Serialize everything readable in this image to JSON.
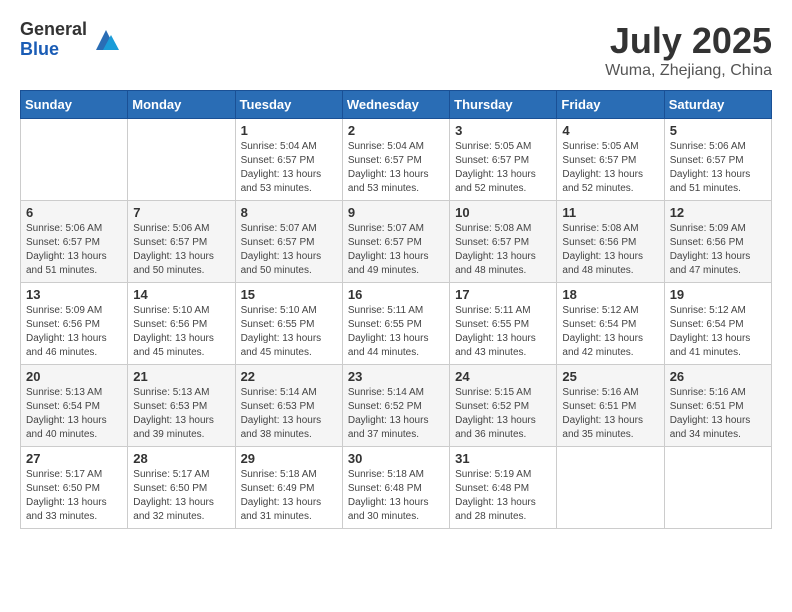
{
  "header": {
    "logo_general": "General",
    "logo_blue": "Blue",
    "month_title": "July 2025",
    "location": "Wuma, Zhejiang, China"
  },
  "days_of_week": [
    "Sunday",
    "Monday",
    "Tuesday",
    "Wednesday",
    "Thursday",
    "Friday",
    "Saturday"
  ],
  "weeks": [
    [
      {
        "day": "",
        "info": ""
      },
      {
        "day": "",
        "info": ""
      },
      {
        "day": "1",
        "info": "Sunrise: 5:04 AM\nSunset: 6:57 PM\nDaylight: 13 hours and 53 minutes."
      },
      {
        "day": "2",
        "info": "Sunrise: 5:04 AM\nSunset: 6:57 PM\nDaylight: 13 hours and 53 minutes."
      },
      {
        "day": "3",
        "info": "Sunrise: 5:05 AM\nSunset: 6:57 PM\nDaylight: 13 hours and 52 minutes."
      },
      {
        "day": "4",
        "info": "Sunrise: 5:05 AM\nSunset: 6:57 PM\nDaylight: 13 hours and 52 minutes."
      },
      {
        "day": "5",
        "info": "Sunrise: 5:06 AM\nSunset: 6:57 PM\nDaylight: 13 hours and 51 minutes."
      }
    ],
    [
      {
        "day": "6",
        "info": "Sunrise: 5:06 AM\nSunset: 6:57 PM\nDaylight: 13 hours and 51 minutes."
      },
      {
        "day": "7",
        "info": "Sunrise: 5:06 AM\nSunset: 6:57 PM\nDaylight: 13 hours and 50 minutes."
      },
      {
        "day": "8",
        "info": "Sunrise: 5:07 AM\nSunset: 6:57 PM\nDaylight: 13 hours and 50 minutes."
      },
      {
        "day": "9",
        "info": "Sunrise: 5:07 AM\nSunset: 6:57 PM\nDaylight: 13 hours and 49 minutes."
      },
      {
        "day": "10",
        "info": "Sunrise: 5:08 AM\nSunset: 6:57 PM\nDaylight: 13 hours and 48 minutes."
      },
      {
        "day": "11",
        "info": "Sunrise: 5:08 AM\nSunset: 6:56 PM\nDaylight: 13 hours and 48 minutes."
      },
      {
        "day": "12",
        "info": "Sunrise: 5:09 AM\nSunset: 6:56 PM\nDaylight: 13 hours and 47 minutes."
      }
    ],
    [
      {
        "day": "13",
        "info": "Sunrise: 5:09 AM\nSunset: 6:56 PM\nDaylight: 13 hours and 46 minutes."
      },
      {
        "day": "14",
        "info": "Sunrise: 5:10 AM\nSunset: 6:56 PM\nDaylight: 13 hours and 45 minutes."
      },
      {
        "day": "15",
        "info": "Sunrise: 5:10 AM\nSunset: 6:55 PM\nDaylight: 13 hours and 45 minutes."
      },
      {
        "day": "16",
        "info": "Sunrise: 5:11 AM\nSunset: 6:55 PM\nDaylight: 13 hours and 44 minutes."
      },
      {
        "day": "17",
        "info": "Sunrise: 5:11 AM\nSunset: 6:55 PM\nDaylight: 13 hours and 43 minutes."
      },
      {
        "day": "18",
        "info": "Sunrise: 5:12 AM\nSunset: 6:54 PM\nDaylight: 13 hours and 42 minutes."
      },
      {
        "day": "19",
        "info": "Sunrise: 5:12 AM\nSunset: 6:54 PM\nDaylight: 13 hours and 41 minutes."
      }
    ],
    [
      {
        "day": "20",
        "info": "Sunrise: 5:13 AM\nSunset: 6:54 PM\nDaylight: 13 hours and 40 minutes."
      },
      {
        "day": "21",
        "info": "Sunrise: 5:13 AM\nSunset: 6:53 PM\nDaylight: 13 hours and 39 minutes."
      },
      {
        "day": "22",
        "info": "Sunrise: 5:14 AM\nSunset: 6:53 PM\nDaylight: 13 hours and 38 minutes."
      },
      {
        "day": "23",
        "info": "Sunrise: 5:14 AM\nSunset: 6:52 PM\nDaylight: 13 hours and 37 minutes."
      },
      {
        "day": "24",
        "info": "Sunrise: 5:15 AM\nSunset: 6:52 PM\nDaylight: 13 hours and 36 minutes."
      },
      {
        "day": "25",
        "info": "Sunrise: 5:16 AM\nSunset: 6:51 PM\nDaylight: 13 hours and 35 minutes."
      },
      {
        "day": "26",
        "info": "Sunrise: 5:16 AM\nSunset: 6:51 PM\nDaylight: 13 hours and 34 minutes."
      }
    ],
    [
      {
        "day": "27",
        "info": "Sunrise: 5:17 AM\nSunset: 6:50 PM\nDaylight: 13 hours and 33 minutes."
      },
      {
        "day": "28",
        "info": "Sunrise: 5:17 AM\nSunset: 6:50 PM\nDaylight: 13 hours and 32 minutes."
      },
      {
        "day": "29",
        "info": "Sunrise: 5:18 AM\nSunset: 6:49 PM\nDaylight: 13 hours and 31 minutes."
      },
      {
        "day": "30",
        "info": "Sunrise: 5:18 AM\nSunset: 6:48 PM\nDaylight: 13 hours and 30 minutes."
      },
      {
        "day": "31",
        "info": "Sunrise: 5:19 AM\nSunset: 6:48 PM\nDaylight: 13 hours and 28 minutes."
      },
      {
        "day": "",
        "info": ""
      },
      {
        "day": "",
        "info": ""
      }
    ]
  ]
}
